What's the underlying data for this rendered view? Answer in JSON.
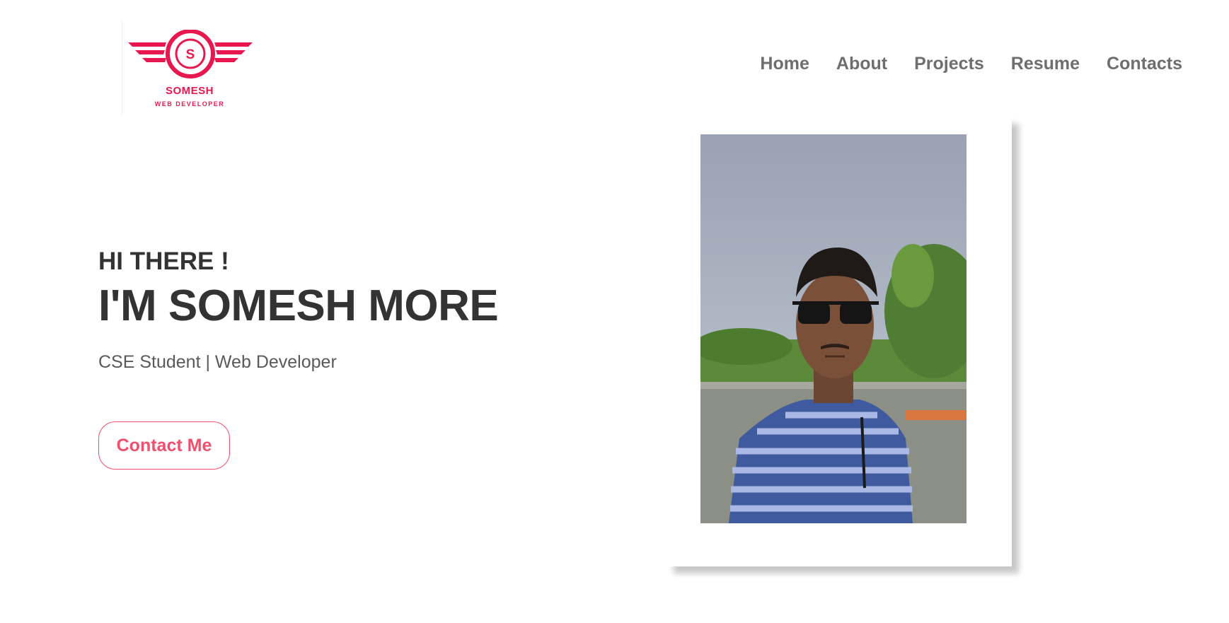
{
  "logo": {
    "initial": "S",
    "name": "SOMESH",
    "tagline": "WEB DEVELOPER",
    "color": "#e8174f"
  },
  "nav": {
    "items": [
      "Home",
      "About",
      "Projects",
      "Resume",
      "Contacts"
    ]
  },
  "hero": {
    "greeting": "HI THERE !",
    "name": "I'M SOMESH MORE",
    "role": "CSE Student | Web Developer",
    "cta_label": "Contact Me",
    "accent": "#f0506e"
  },
  "photo": {
    "alt": "portrait photo"
  }
}
